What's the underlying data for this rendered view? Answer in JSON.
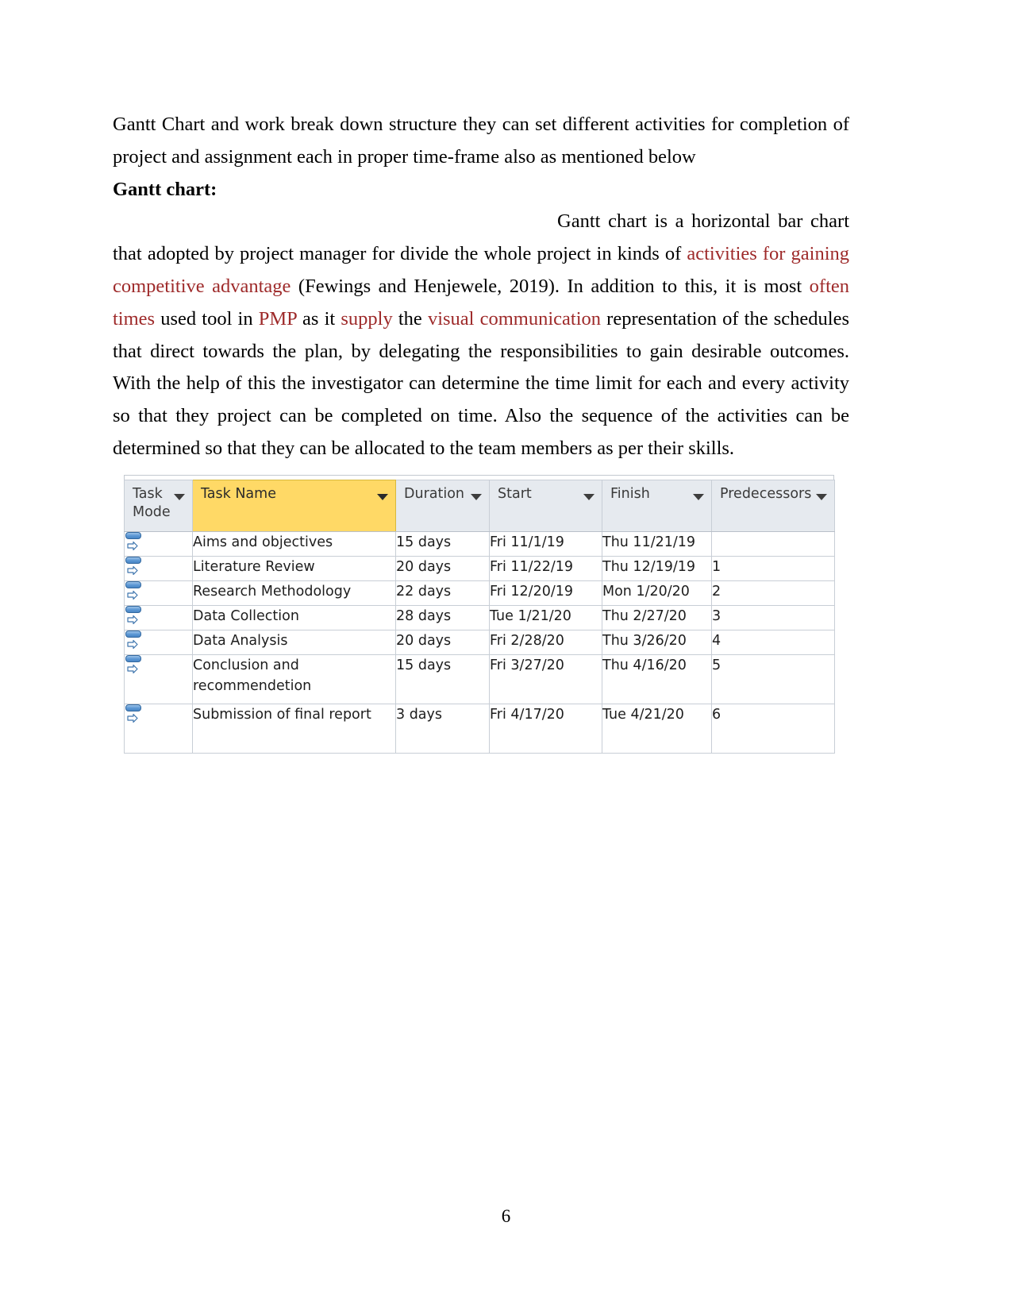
{
  "document": {
    "page_number": "6",
    "intro_paragraph": {
      "text": "Gantt Chart and work break down structure they can  set different activities for completion of project and assignment each in proper time-frame also as mentioned below"
    },
    "heading": "Gantt chart:",
    "main_paragraph": {
      "segments": [
        {
          "text": "Gantt chart is a horizontal bar chart that adopted by project manager for divide the whole project in kinds of ",
          "color": "black"
        },
        {
          "text": "activities for gaining competitive advantage",
          "color": "red"
        },
        {
          "text": " (Fewings and Henjewele,  2019). In addition to this, it is most ",
          "color": "black"
        },
        {
          "text": "often times",
          "color": "red"
        },
        {
          "text": " used tool in ",
          "color": "black"
        },
        {
          "text": "PMP",
          "color": "red"
        },
        {
          "text": " as it ",
          "color": "black"
        },
        {
          "text": "supply",
          "color": "red"
        },
        {
          "text": " the ",
          "color": "black"
        },
        {
          "text": "visual communication",
          "color": "red"
        },
        {
          "text": " representation of the schedules that direct  towards the plan, by delegating the responsibilities to gain desirable outcomes. With the help of this the investigator can determine the time limit for each and every activity so that they project can be completed on time. Also the sequence of the activities can be determined so that they can be allocated to the team members as per their skills.",
          "color": "black"
        }
      ],
      "lead_in": "Gantt chart is a",
      "body_rest": "horizontal bar chart that adopted by project manager for divide the whole project in kinds of ",
      "red_1": "activities for gaining competitive advantage",
      "after_red_1": " (Fewings and Henjewele,  2019). In addition to this, it is most ",
      "red_2": "often times",
      "after_red_2": " used tool in ",
      "red_3": "PMP",
      "after_red_3": " as it ",
      "red_4": "supply",
      "after_red_4": " the ",
      "red_5": "visual communication",
      "after_red_5": " representation of the schedules that direct  towards the plan, by delegating the responsibilities to gain desirable outcomes. With the help of this the investigator can determine the time limit for each and every activity so that they project can be completed on time. Also the sequence of the activities can be determined so that they can be allocated to the team members as per their skills."
    }
  },
  "colors": {
    "accent_red": "#9e2a2a",
    "header_fill": "#e6eaef",
    "taskname_highlight": "#ffd966",
    "grid_line": "#c8ced6",
    "icon_blue": "#4a86c5"
  },
  "gantt_table": {
    "columns": [
      {
        "key": "task_mode",
        "label": "Task Mode",
        "has_filter": true,
        "highlight": false
      },
      {
        "key": "task_name",
        "label": "Task Name",
        "has_filter": true,
        "highlight": true
      },
      {
        "key": "duration",
        "label": "Duration",
        "has_filter": true,
        "highlight": false
      },
      {
        "key": "start",
        "label": "Start",
        "has_filter": true,
        "highlight": false
      },
      {
        "key": "finish",
        "label": "Finish",
        "has_filter": true,
        "highlight": false
      },
      {
        "key": "predecessors",
        "label": "Predecessors",
        "has_filter": true,
        "highlight": false
      }
    ],
    "rows": [
      {
        "task_mode_icon": "auto-scheduled-icon",
        "task_name": "Aims and objectives",
        "duration": "15 days",
        "start": "Fri 11/1/19",
        "finish": "Thu 11/21/19",
        "predecessors": ""
      },
      {
        "task_mode_icon": "auto-scheduled-icon",
        "task_name": "Literature Review",
        "duration": "20 days",
        "start": "Fri 11/22/19",
        "finish": "Thu 12/19/19",
        "predecessors": "1"
      },
      {
        "task_mode_icon": "auto-scheduled-icon",
        "task_name": "Research Methodology",
        "duration": "22 days",
        "start": "Fri 12/20/19",
        "finish": "Mon 1/20/20",
        "predecessors": "2"
      },
      {
        "task_mode_icon": "auto-scheduled-icon",
        "task_name": "Data Collection",
        "duration": "28 days",
        "start": "Tue 1/21/20",
        "finish": "Thu 2/27/20",
        "predecessors": "3"
      },
      {
        "task_mode_icon": "auto-scheduled-icon",
        "task_name": "Data Analysis",
        "duration": "20 days",
        "start": "Fri 2/28/20",
        "finish": "Thu 3/26/20",
        "predecessors": "4"
      },
      {
        "task_mode_icon": "auto-scheduled-icon",
        "task_name": "Conclusion and recommendetion",
        "duration": "15 days",
        "start": "Fri 3/27/20",
        "finish": "Thu 4/16/20",
        "predecessors": "5"
      },
      {
        "task_mode_icon": "auto-scheduled-icon",
        "task_name": "Submission of final report",
        "duration": "3 days",
        "start": "Fri 4/17/20",
        "finish": "Tue 4/21/20",
        "predecessors": "6"
      }
    ]
  }
}
